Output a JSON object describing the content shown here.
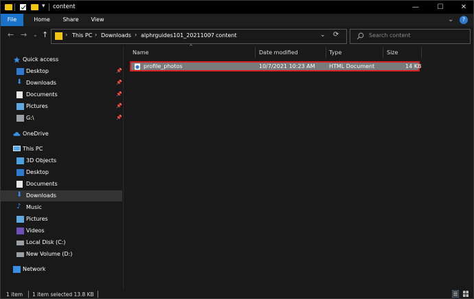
{
  "window": {
    "title": "content"
  },
  "ribbon": {
    "tabs": [
      "File",
      "Home",
      "Share",
      "View"
    ]
  },
  "address": {
    "crumbs": [
      "This PC",
      "Downloads",
      "alphrguides101_20211007",
      "content"
    ]
  },
  "search": {
    "placeholder": "Search content"
  },
  "nav": {
    "quick_access": "Quick access",
    "qa_items": [
      "Desktop",
      "Downloads",
      "Documents",
      "Pictures",
      "G:\\"
    ],
    "onedrive": "OneDrive",
    "this_pc": "This PC",
    "pc_items": [
      "3D Objects",
      "Desktop",
      "Documents",
      "Downloads",
      "Music",
      "Pictures",
      "Videos",
      "Local Disk (C:)",
      "New Volume (D:)"
    ],
    "network": "Network",
    "selected": "Downloads"
  },
  "columns": {
    "name": "Name",
    "date": "Date modified",
    "type": "Type",
    "size": "Size"
  },
  "files": [
    {
      "name": "profile_photos",
      "date": "10/7/2021 10:23 AM",
      "type": "HTML Document",
      "size": "14 KB"
    }
  ],
  "status": {
    "count": "1 item",
    "selected": "1 item selected  13.8 KB"
  },
  "colors": {
    "accent": "#1a73c8",
    "highlight_border": "#d51f1f",
    "folder": "#f1c40f"
  }
}
